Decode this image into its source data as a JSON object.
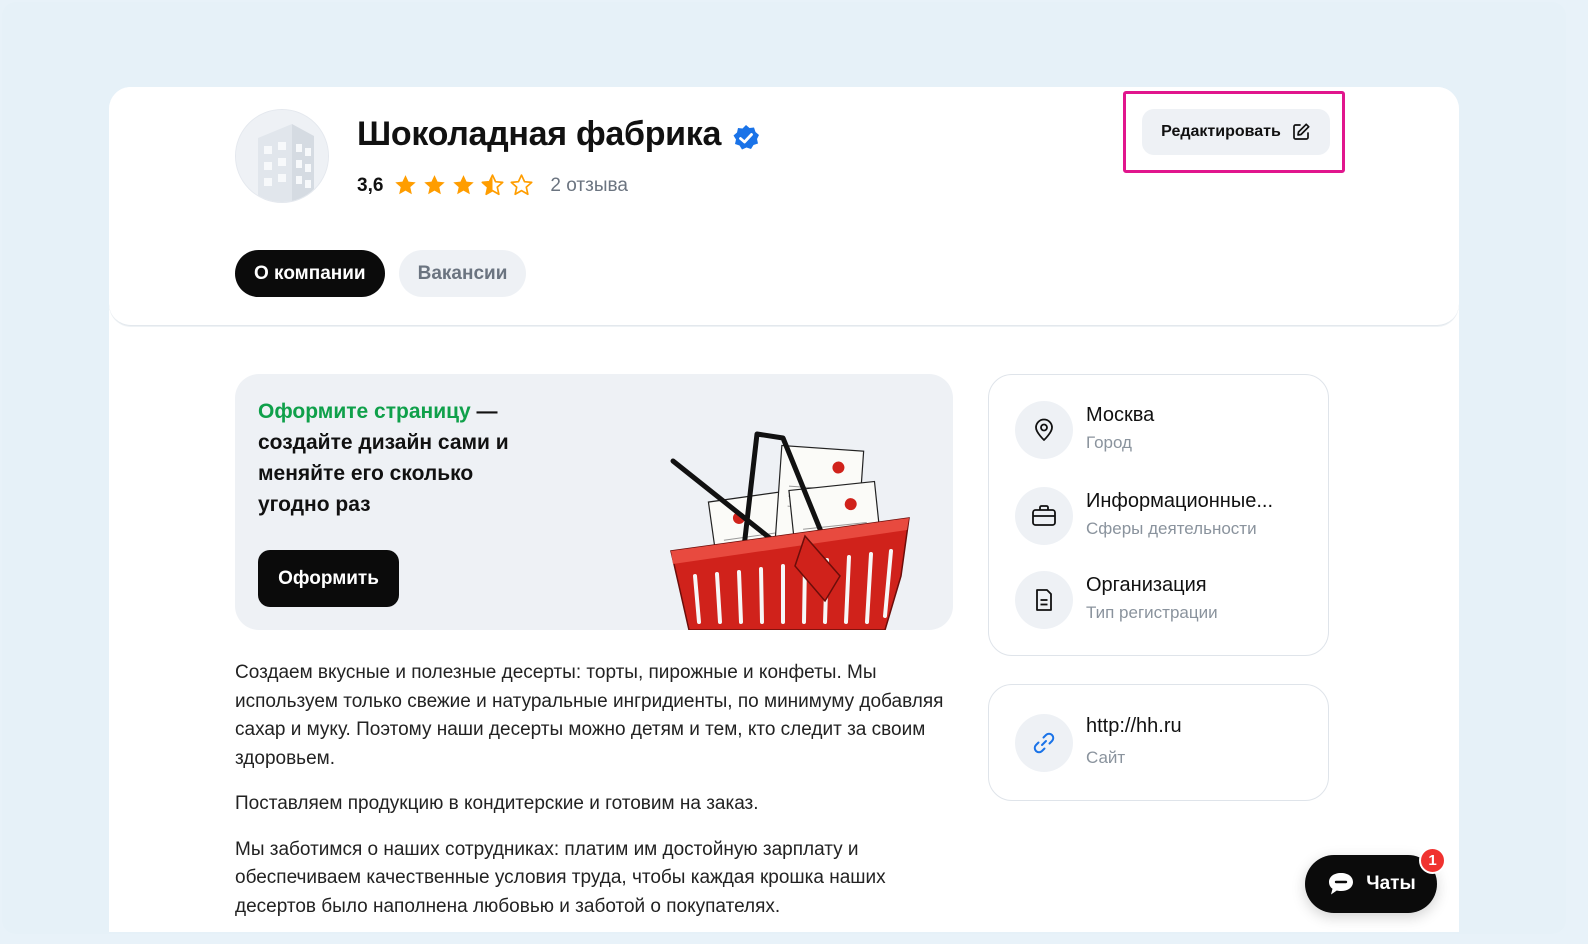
{
  "company": {
    "name": "Шоколадная фабрика",
    "rating": "3,6",
    "reviews": "2 отзыва",
    "stars_value": 3.6
  },
  "edit_button": {
    "label": "Редактировать"
  },
  "tabs": [
    {
      "label": "О компании",
      "active": true
    },
    {
      "label": "Вакансии",
      "active": false
    }
  ],
  "promo": {
    "accent_text": "Оформите страницу",
    "text": " — создайте дизайн сами и меняйте его сколько угодно раз",
    "button_label": "Оформить"
  },
  "description": [
    "Создаем вкусные и полезные десерты: торты, пирожные и конфеты. Мы используем только свежие и натуральные ингридиенты, по минимуму добавляя сахар и муку. Поэтому наши десерты можно детям и тем, кто следит за своим здоровьем.",
    "Поставляем продукцию в кондитерские и готовим на заказ.",
    "Мы заботимся о наших сотрудниках: платим им достойную зарплату и обеспечиваем качественные условия труда, чтобы каждая крошка наших десертов было наполнена любовью и заботой о покупателях."
  ],
  "info": [
    {
      "title": "Москва",
      "subtitle": "Город",
      "icon": "location-pin-icon"
    },
    {
      "title": "Информационные...",
      "subtitle": "Сферы деятельности",
      "icon": "briefcase-icon"
    },
    {
      "title": "Организация",
      "subtitle": "Тип регистрации",
      "icon": "document-icon"
    }
  ],
  "site": {
    "title": "http://hh.ru",
    "subtitle": "Сайт",
    "icon": "link-icon"
  },
  "chat": {
    "label": "Чаты",
    "badge": "1"
  },
  "colors": {
    "accent_green": "#0fa04a",
    "verified_blue": "#1a73e8",
    "star": "#ff9d00",
    "highlight": "#e1168d",
    "badge_red": "#f0322f"
  }
}
